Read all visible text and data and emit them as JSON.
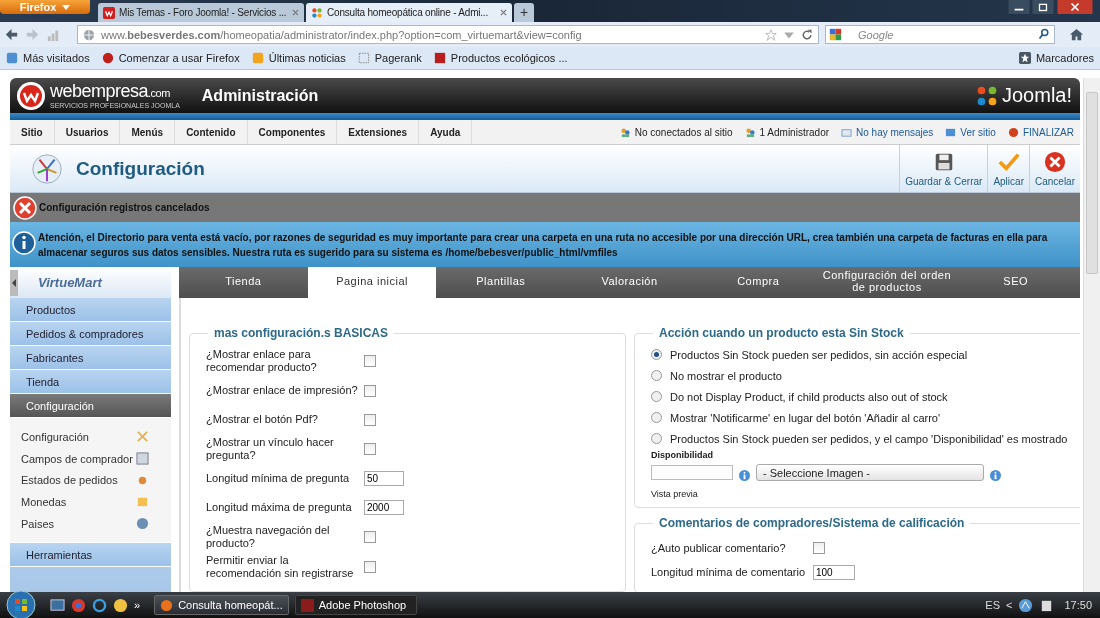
{
  "browser": {
    "firefox_button": "Firefox",
    "tabs": [
      {
        "title": "Mis Temas - Foro Joomla! - Servicios ...",
        "selected": false
      },
      {
        "title": "Consulta homeopática online - Admi...",
        "selected": true
      }
    ],
    "new_tab": "+",
    "url": "www.**bebesverdes.com**/homeopatia/administrator/index.php?option=com_virtuemart&view=config",
    "search": {
      "placeholder": "Google"
    },
    "bookmarks": [
      "Más visitados",
      "Comenzar a usar Firefox",
      "Últimas noticias",
      "Pagerank",
      "Productos ecológicos ..."
    ],
    "bookmarks_menu": "Marcadores"
  },
  "admin": {
    "brand": "webempresa",
    "brand_suffix": ".com",
    "brand_tagline": "SERVICIOS PROFESIONALES JOOMLA",
    "title": "Administración",
    "cms_logo": "Joomla!",
    "menu": [
      "Sitio",
      "Usuarios",
      "Menús",
      "Contenido",
      "Componentes",
      "Extensiones",
      "Ayuda"
    ],
    "status": [
      {
        "text": "No conectados al sitio",
        "kind": "plain"
      },
      {
        "text": "1 Administrador",
        "kind": "plain"
      },
      {
        "text": "No hay mensajes",
        "kind": "link"
      },
      {
        "text": "Ver sitio",
        "kind": "link"
      },
      {
        "text": "FINALIZAR",
        "kind": "link"
      }
    ],
    "page_title": "Configuración",
    "toolbar": [
      "Guardar & Cerrar",
      "Aplicar",
      "Cancelar"
    ],
    "error_message": "Configuración registros cancelados",
    "notice_message": "Atención, el Directorio para venta está vacío, por razones de seguridad es muy importante para crear una carpeta en una ruta no accesible por una dirección URL, crea también una carpeta de facturas en ella para almacenar seguros sus datos sensibles. Nuestra ruta es sugerido para su sistema es /home/bebesver/public_html/vmfiles"
  },
  "sidebar": {
    "logo": "VirtueMart",
    "items": [
      {
        "label": "Productos",
        "selected": false
      },
      {
        "label": "Pedidos & compradores",
        "selected": false
      },
      {
        "label": "Fabricantes",
        "selected": false
      },
      {
        "label": "Tienda",
        "selected": false
      },
      {
        "label": "Configuración",
        "selected": true,
        "children": [
          {
            "label": "Configuración"
          },
          {
            "label": "Campos de comprador"
          },
          {
            "label": "Estados de pedidos"
          },
          {
            "label": "Monedas"
          },
          {
            "label": "Paises"
          }
        ]
      },
      {
        "label": "Herramientas",
        "selected": false
      }
    ]
  },
  "tabs": [
    {
      "label": "Tienda",
      "selected": false
    },
    {
      "label": "Pagina inicial",
      "selected": true
    },
    {
      "label": "Plantillas",
      "selected": false
    },
    {
      "label": "Valoración",
      "selected": false
    },
    {
      "label": "Compra",
      "selected": false
    },
    {
      "label": "Configuración del orden de productos",
      "selected": false
    },
    {
      "label": "SEO",
      "selected": false
    }
  ],
  "basic": {
    "title": "mas configuración.s BASICAS",
    "rows": [
      {
        "kind": "checkbox",
        "label": "¿Mostrar enlace para recomendar producto?",
        "checked": false
      },
      {
        "kind": "checkbox",
        "label": "¿Mostrar enlace de impresión?",
        "checked": false
      },
      {
        "kind": "checkbox",
        "label": "¿Mostrar el botón Pdf?",
        "checked": false
      },
      {
        "kind": "checkbox",
        "label": "¿Mostrar un vínculo hacer pregunta?",
        "checked": false
      },
      {
        "kind": "text",
        "label": "Longitud mínima de pregunta",
        "value": "50"
      },
      {
        "kind": "text",
        "label": "Longitud máxima de pregunta",
        "value": "2000"
      },
      {
        "kind": "checkbox",
        "label": "¿Muestra navegación del producto?",
        "checked": false
      },
      {
        "kind": "checkbox",
        "label": "Permitir enviar la recomendación sin registrarse",
        "checked": false
      }
    ]
  },
  "stock": {
    "title": "Acción cuando un producto esta Sin Stock",
    "options": [
      {
        "label": "Productos Sin Stock pueden ser pedidos, sin acción especial",
        "selected": true
      },
      {
        "label": "No mostrar el producto",
        "selected": false
      },
      {
        "label": "Do not Display Product, if child products also out of stock",
        "selected": false
      },
      {
        "label": "Mostrar 'Notificarme' en lugar del botón 'Añadir al carro'",
        "selected": false
      },
      {
        "label": "Productos Sin Stock pueden ser pedidos, y el campo 'Disponibilidad' es mostrado",
        "selected": false
      }
    ],
    "availability_label": "Disponibilidad",
    "image_select": "- Seleccione Imagen -",
    "preview_label": "Vista previa"
  },
  "reviews": {
    "title": "Comentarios de compradores/Sistema de calificación",
    "rows": [
      {
        "kind": "checkbox",
        "label": "¿Auto publicar comentario?",
        "checked": false
      },
      {
        "kind": "text",
        "label": "Longitud mínima de comentario",
        "value": "100"
      }
    ]
  },
  "taskbar": {
    "more": "»",
    "windows": [
      {
        "label": "Consulta homeopát...",
        "selected": true
      },
      {
        "label": "Adobe Photoshop",
        "selected": false
      }
    ],
    "language": "ES",
    "tray_toggle": "<",
    "time": "17:50"
  }
}
